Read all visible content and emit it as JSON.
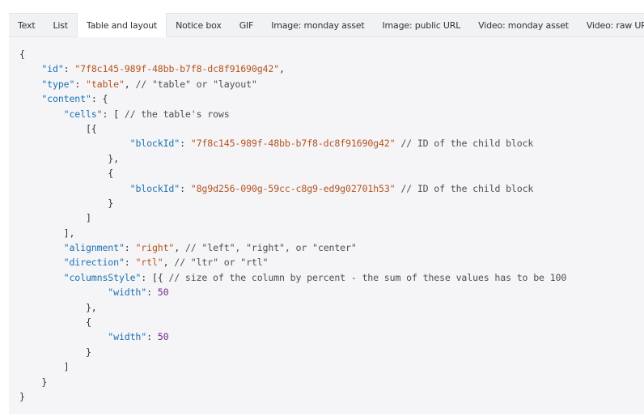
{
  "tabs": [
    {
      "label": "Text",
      "active": false
    },
    {
      "label": "List",
      "active": false
    },
    {
      "label": "Table and layout",
      "active": true
    },
    {
      "label": "Notice box",
      "active": false
    },
    {
      "label": "GIF",
      "active": false
    },
    {
      "label": "Image: monday asset",
      "active": false
    },
    {
      "label": "Image: public URL",
      "active": false
    },
    {
      "label": "Video: monday asset",
      "active": false
    },
    {
      "label": "Video: raw URL",
      "active": false
    }
  ],
  "colors": {
    "key": "#1a72b4",
    "string": "#b55320",
    "number": "#6d2a8c",
    "comment": "#4e4f57",
    "punct": "#323338",
    "panel_bg": "#f5f5f7",
    "tabs_bg": "#f1f2f4"
  },
  "code_lines": [
    [
      {
        "t": "p",
        "v": "{"
      }
    ],
    [
      {
        "t": "p",
        "v": "    "
      },
      {
        "t": "k",
        "v": "\"id\""
      },
      {
        "t": "p",
        "v": ": "
      },
      {
        "t": "s",
        "v": "\"7f8c145-989f-48bb-b7f8-dc8f91690g42\""
      },
      {
        "t": "p",
        "v": ","
      }
    ],
    [
      {
        "t": "p",
        "v": "    "
      },
      {
        "t": "k",
        "v": "\"type\""
      },
      {
        "t": "p",
        "v": ": "
      },
      {
        "t": "s",
        "v": "\"table\""
      },
      {
        "t": "p",
        "v": ", "
      },
      {
        "t": "c",
        "v": "// \"table\" or \"layout\""
      }
    ],
    [
      {
        "t": "p",
        "v": "    "
      },
      {
        "t": "k",
        "v": "\"content\""
      },
      {
        "t": "p",
        "v": ": {"
      }
    ],
    [
      {
        "t": "p",
        "v": "        "
      },
      {
        "t": "k",
        "v": "\"cells\""
      },
      {
        "t": "p",
        "v": ": [ "
      },
      {
        "t": "c",
        "v": "// the table's rows"
      }
    ],
    [
      {
        "t": "p",
        "v": "            [{"
      }
    ],
    [
      {
        "t": "p",
        "v": "                    "
      },
      {
        "t": "k",
        "v": "\"blockId\""
      },
      {
        "t": "p",
        "v": ": "
      },
      {
        "t": "s",
        "v": "\"7f8c145-989f-48bb-b7f8-dc8f91690g42\""
      },
      {
        "t": "p",
        "v": " "
      },
      {
        "t": "c",
        "v": "// ID of the child block"
      }
    ],
    [
      {
        "t": "p",
        "v": "                },"
      }
    ],
    [
      {
        "t": "p",
        "v": "                {"
      }
    ],
    [
      {
        "t": "p",
        "v": "                    "
      },
      {
        "t": "k",
        "v": "\"blockId\""
      },
      {
        "t": "p",
        "v": ": "
      },
      {
        "t": "s",
        "v": "\"8g9d256-090g-59cc-c8g9-ed9g02701h53\""
      },
      {
        "t": "p",
        "v": " "
      },
      {
        "t": "c",
        "v": "// ID of the child block"
      }
    ],
    [
      {
        "t": "p",
        "v": "                }"
      }
    ],
    [
      {
        "t": "p",
        "v": "            ]"
      }
    ],
    [
      {
        "t": "p",
        "v": "        ],"
      }
    ],
    [
      {
        "t": "p",
        "v": "        "
      },
      {
        "t": "k",
        "v": "\"alignment\""
      },
      {
        "t": "p",
        "v": ": "
      },
      {
        "t": "s",
        "v": "\"right\""
      },
      {
        "t": "p",
        "v": ", "
      },
      {
        "t": "c",
        "v": "// \"left\", \"right\", or \"center\""
      }
    ],
    [
      {
        "t": "p",
        "v": "        "
      },
      {
        "t": "k",
        "v": "\"direction\""
      },
      {
        "t": "p",
        "v": ": "
      },
      {
        "t": "s",
        "v": "\"rtl\""
      },
      {
        "t": "p",
        "v": ", "
      },
      {
        "t": "c",
        "v": "// \"ltr\" or \"rtl\""
      }
    ],
    [
      {
        "t": "p",
        "v": "        "
      },
      {
        "t": "k",
        "v": "\"columnsStyle\""
      },
      {
        "t": "p",
        "v": ": [{ "
      },
      {
        "t": "c",
        "v": "// size of the column by percent - the sum of these values has to be 100"
      }
    ],
    [
      {
        "t": "p",
        "v": "                "
      },
      {
        "t": "k",
        "v": "\"width\""
      },
      {
        "t": "p",
        "v": ": "
      },
      {
        "t": "n",
        "v": "50"
      }
    ],
    [
      {
        "t": "p",
        "v": "            },"
      }
    ],
    [
      {
        "t": "p",
        "v": "            {"
      }
    ],
    [
      {
        "t": "p",
        "v": "                "
      },
      {
        "t": "k",
        "v": "\"width\""
      },
      {
        "t": "p",
        "v": ": "
      },
      {
        "t": "n",
        "v": "50"
      }
    ],
    [
      {
        "t": "p",
        "v": "            }"
      }
    ],
    [
      {
        "t": "p",
        "v": "        ]"
      }
    ],
    [
      {
        "t": "p",
        "v": "    }"
      }
    ],
    [
      {
        "t": "p",
        "v": "}"
      }
    ]
  ]
}
